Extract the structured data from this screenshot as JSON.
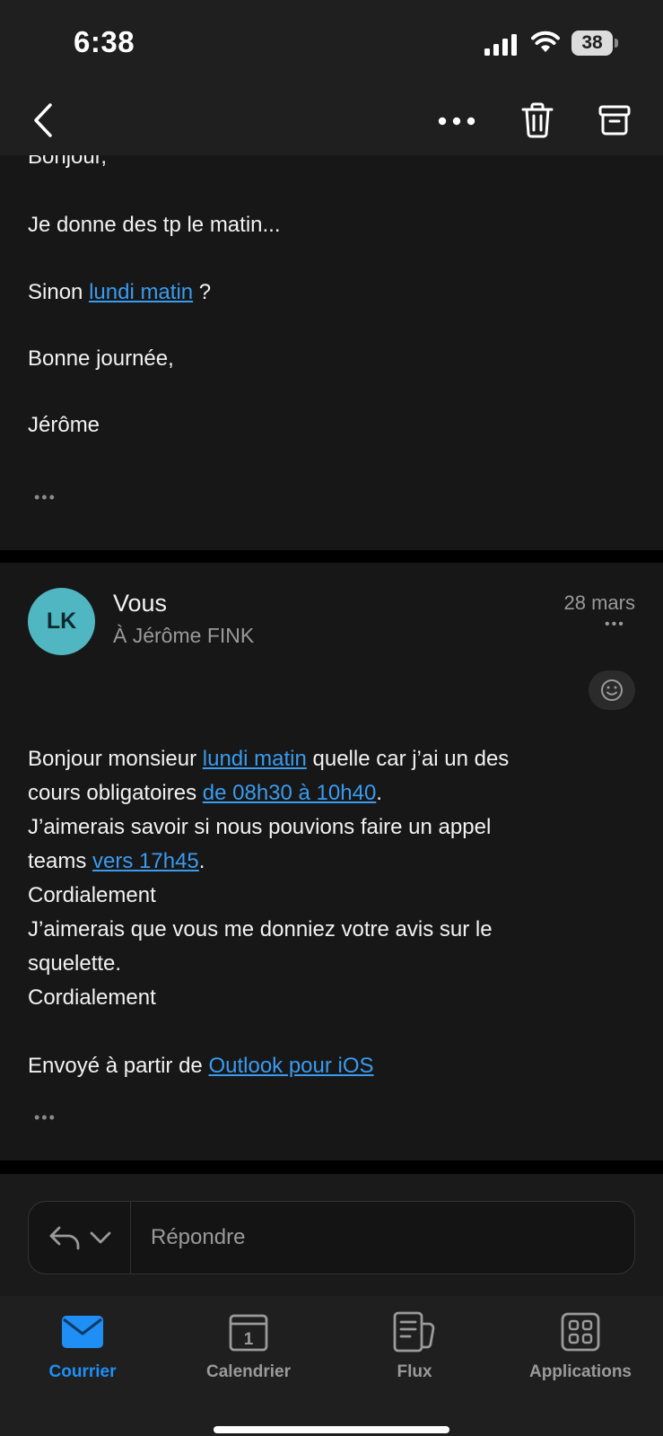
{
  "status_bar": {
    "time": "6:38",
    "battery": "38"
  },
  "nav": {
    "back_icon": "chevron-left-icon",
    "more_icon": "ellipsis-icon",
    "delete_icon": "trash-icon",
    "archive_icon": "archive-icon"
  },
  "message1": {
    "greeting": "Bonjour,",
    "line1": "Je donne des tp le matin...",
    "line2_prefix": "Sinon ",
    "line2_link": "lundi matin",
    "line2_suffix": " ?",
    "closing": "Bonne journée,",
    "signature": "Jérôme",
    "more": "•••"
  },
  "message2": {
    "avatar_initials": "LK",
    "sender": "Vous",
    "recipient": "À Jérôme FINK",
    "date": "28 mars",
    "more": "•••",
    "body": {
      "l1_a": "Bonjour monsieur ",
      "l1_link": "lundi matin",
      "l1_b": " quelle car j’ai un des",
      "l2_a": "cours obligatoires ",
      "l2_link": "de 08h30 à 10h40",
      "l2_b": ".",
      "l3": "J’aimerais savoir si nous pouvions faire un appel",
      "l4_a": "teams ",
      "l4_link": "vers 17h45",
      "l4_b": ".",
      "l5": "Cordialement",
      "l6": "J’aimerais que vous me donniez votre avis sur le",
      "l7": "squelette.",
      "l8": "Cordialement",
      "sig_a": "Envoyé à partir de ",
      "sig_link": "Outlook pour iOS"
    },
    "footer_more": "•••"
  },
  "reply": {
    "placeholder": "Répondre"
  },
  "tabs": [
    {
      "label": "Courrier",
      "icon": "mail-icon",
      "active": true
    },
    {
      "label": "Calendrier",
      "icon": "calendar-icon",
      "day": "1",
      "active": false
    },
    {
      "label": "Flux",
      "icon": "feed-icon",
      "active": false
    },
    {
      "label": "Applications",
      "icon": "apps-grid-icon",
      "active": false
    }
  ],
  "colors": {
    "accent": "#1f8ff5",
    "link": "#3a9bef",
    "avatar": "#4fb6c2"
  }
}
